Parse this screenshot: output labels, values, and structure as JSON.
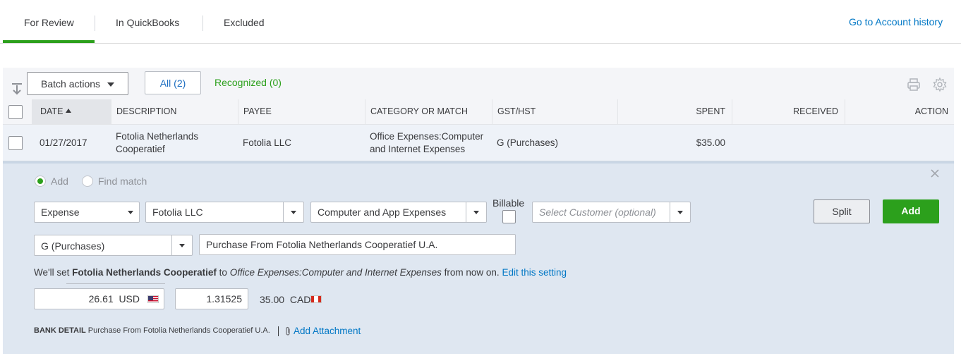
{
  "tabs": {
    "for_review": "For Review",
    "in_quickbooks": "In QuickBooks",
    "excluded": "Excluded",
    "account_history_link": "Go to Account history"
  },
  "toolbar": {
    "batch_actions": "Batch actions",
    "filter_all": "All (2)",
    "filter_recognized": "Recognized (0)"
  },
  "table": {
    "headers": {
      "date": "DATE",
      "description": "DESCRIPTION",
      "payee": "PAYEE",
      "category": "CATEGORY OR MATCH",
      "gst": "GST/HST",
      "spent": "SPENT",
      "received": "RECEIVED",
      "action": "ACTION"
    },
    "rows": [
      {
        "date": "01/27/2017",
        "description_line1": "Fotolia Netherlands",
        "description_line2": "Cooperatief",
        "payee": "Fotolia LLC",
        "category_line1": "Office Expenses:Computer",
        "category_line2": "and Internet Expenses",
        "gst": "G (Purchases)",
        "spent": "$35.00",
        "received": ""
      }
    ]
  },
  "detail": {
    "radio_add": "Add",
    "radio_find_match": "Find match",
    "type_select": "Expense",
    "payee_select": "Fotolia LLC",
    "category_select": "Computer and App Expenses",
    "billable_label": "Billable",
    "customer_placeholder": "Select Customer (optional)",
    "split_button": "Split",
    "add_button": "Add",
    "tax_select": "G (Purchases)",
    "memo_value": "Purchase From Fotolia Netherlands Cooperatief U.A.",
    "rule_prefix": "We'll set",
    "rule_payee": "Fotolia Netherlands Cooperatief",
    "rule_to": "to",
    "rule_category": "Office Expenses:Computer and Internet Expenses",
    "rule_suffix": "from now on.",
    "rule_edit_link": "Edit this setting",
    "usd_amount": "26.61",
    "usd_code": "USD",
    "exchange_rate": "1.31525",
    "cad_amount": "35.00",
    "cad_code": "CAD",
    "bank_detail_label": "BANK DETAIL",
    "bank_detail_value": "Purchase From Fotolia Netherlands Cooperatief U.A.",
    "add_attachment": "Add Attachment"
  },
  "colors": {
    "accent_green": "#2ca01c",
    "link_blue": "#0077c5",
    "panel_bg": "#dfe7f1"
  },
  "icons": [
    "sort-arrow-icon",
    "printer-icon",
    "gear-icon",
    "close-icon",
    "paperclip-icon",
    "us-flag-icon",
    "canada-flag-icon"
  ]
}
